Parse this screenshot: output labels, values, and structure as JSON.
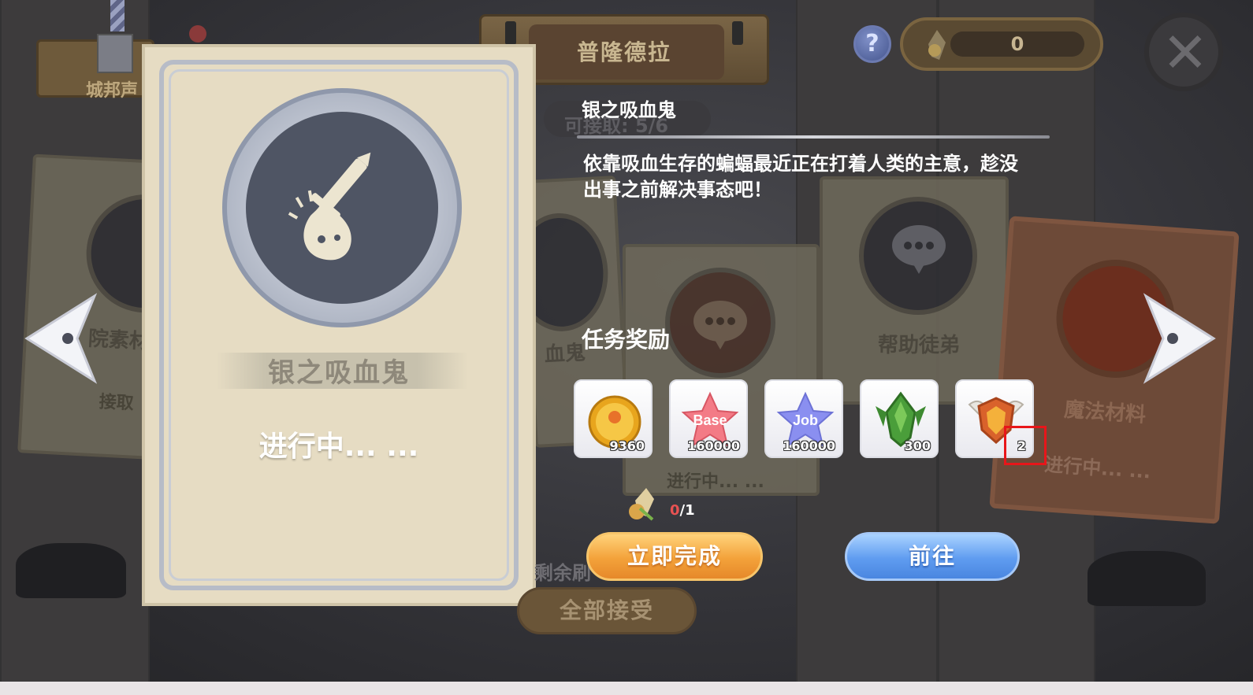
{
  "header": {
    "region_title": "普隆德拉",
    "city_label": "城邦声",
    "help_label": "?",
    "currency_value": "0"
  },
  "quest": {
    "card_name": "银之吸血鬼",
    "card_status": "进行中... ...",
    "title": "银之吸血鬼",
    "available_text": "可接取: 5/6",
    "description": "依靠吸血生存的蝙蝠最近正在打着人类的主意，趁没出事之前解决事态吧！"
  },
  "background_cards": [
    {
      "label": "院素材",
      "sub": "接取"
    },
    {
      "label": "血鬼",
      "sub": ""
    },
    {
      "label": "",
      "sub": "进行中... ..."
    },
    {
      "label": "帮助徒弟",
      "sub": ""
    },
    {
      "label": "魔法材料",
      "sub": "进行中... ..."
    }
  ],
  "rewards": {
    "title": "任务奖励",
    "items": [
      {
        "icon": "zeny-coin-icon",
        "count": "9360"
      },
      {
        "icon": "base-exp-star-icon",
        "label": "Base",
        "count": "160000"
      },
      {
        "icon": "job-exp-star-icon",
        "label": "Job",
        "count": "160000"
      },
      {
        "icon": "green-crystal-icon",
        "count": "300"
      },
      {
        "icon": "winged-shield-badge-icon",
        "count": "2"
      }
    ]
  },
  "requirement": {
    "have": "0",
    "need": "/1",
    "icon": "feather-token-icon"
  },
  "buttons": {
    "complete_now": "立即完成",
    "go": "前往",
    "accept_all": "全部接受",
    "refresh": "剩余刷"
  },
  "colors": {
    "complete_button": "#f3a23a",
    "go_button": "#5f9cf0",
    "highlight_box": "#e8161a"
  }
}
